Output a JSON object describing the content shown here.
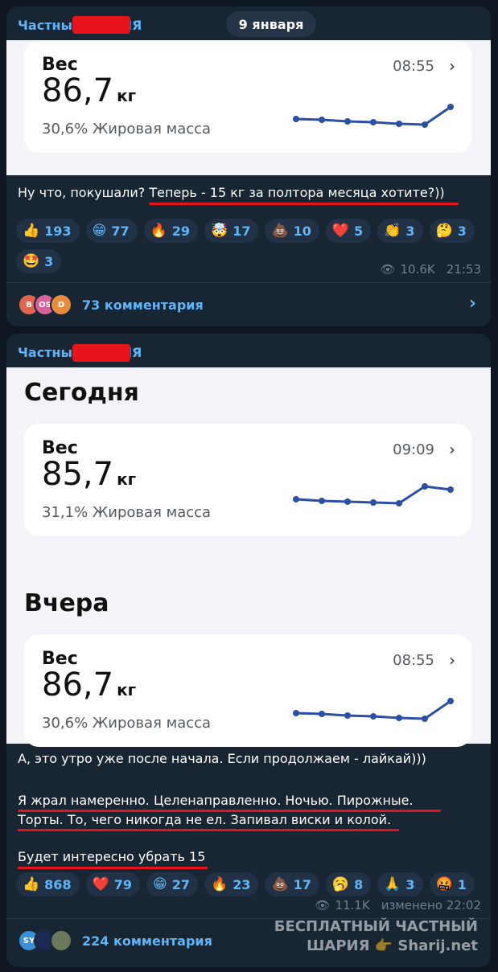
{
  "post1": {
    "channel": "Частный ШАРИЯ",
    "date": "9 января",
    "card": {
      "title": "Вес",
      "value": "86,7",
      "unit": "кг",
      "time": "08:55",
      "sub": "30,6% Жировая масса"
    },
    "message": "Ну что, покушали? Теперь - 15 кг за полтора месяца хотите?))",
    "reactions": [
      {
        "emoji": "👍",
        "count": "193"
      },
      {
        "emoji": "😁",
        "count": "77"
      },
      {
        "emoji": "🔥",
        "count": "29"
      },
      {
        "emoji": "🤯",
        "count": "17"
      },
      {
        "emoji": "💩",
        "count": "10"
      },
      {
        "emoji": "❤️",
        "count": "5"
      },
      {
        "emoji": "👏",
        "count": "3"
      },
      {
        "emoji": "🤔",
        "count": "3"
      },
      {
        "emoji": "🤩",
        "count": "3"
      }
    ],
    "views": "10.6K",
    "time": "21:53",
    "avatars": [
      "B",
      "OS",
      "D"
    ],
    "comments": "73 комментария"
  },
  "post2": {
    "channel": "Частный ШАРИЯ",
    "heading_today": "Сегодня",
    "heading_yesterday": "Вчера",
    "card_today": {
      "title": "Вес",
      "value": "85,7",
      "unit": "кг",
      "time": "09:09",
      "sub": "31,1% Жировая масса"
    },
    "card_yesterday": {
      "title": "Вес",
      "value": "86,7",
      "unit": "кг",
      "time": "08:55",
      "sub": "30,6% Жировая масса"
    },
    "message_lines": [
      "А, это утро уже после начала. Если продолжаем - лайкай)))",
      "Я жрал намеренно. Целенаправленно. Ночью. Пирожные.",
      "Торты. То, чего никогда не ел. Запивал виски и колой.",
      "Будет интересно убрать 15"
    ],
    "reactions": [
      {
        "emoji": "👍",
        "count": "868"
      },
      {
        "emoji": "❤️",
        "count": "79"
      },
      {
        "emoji": "😁",
        "count": "27"
      },
      {
        "emoji": "🔥",
        "count": "23"
      },
      {
        "emoji": "💩",
        "count": "17"
      },
      {
        "emoji": "🥱",
        "count": "8"
      },
      {
        "emoji": "🙏",
        "count": "3"
      },
      {
        "emoji": "🤬",
        "count": "1"
      }
    ],
    "views": "11.1K",
    "edited": "изменено 22:02",
    "avatars": [
      "SY",
      "",
      ""
    ],
    "comments": "224 комментария"
  },
  "watermark": {
    "line1": "БЕСПЛАТНЫЙ ЧАСТНЫЙ",
    "line2": "ШАРИЯ 👉 Sharij.net"
  },
  "colors": {
    "background": "#0e1621",
    "bubble": "#182533",
    "accent": "#5eb5f7",
    "underline": "#e8141c",
    "spark": "#2c4fa6"
  }
}
